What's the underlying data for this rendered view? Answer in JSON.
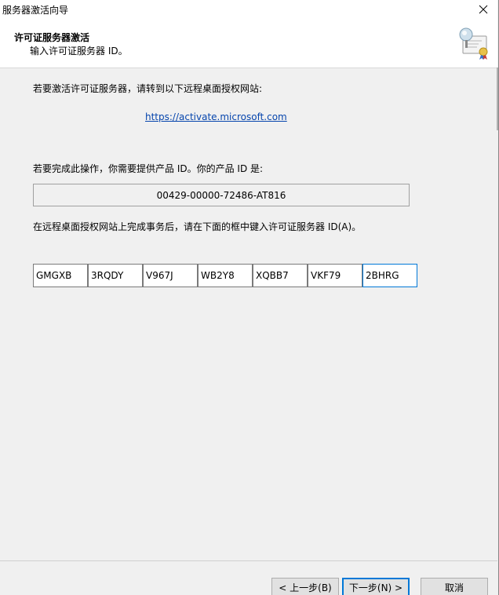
{
  "window": {
    "title": "服务器激活向导"
  },
  "header": {
    "title": "许可证服务器激活",
    "subtitle": "输入许可证服务器 ID。"
  },
  "content": {
    "intro_text": "若要激活许可证服务器，请转到以下远程桌面授权网站:",
    "link_text": "https://activate.microsoft.com",
    "product_id_text": "若要完成此操作，你需要提供产品 ID。你的产品 ID 是:",
    "product_id_value": "00429-00000-72486-AT816",
    "instruction_text": "在远程桌面授权网站上完成事务后，请在下面的框中键入许可证服务器 ID(A)。",
    "license_key_fields": [
      "GMGXB",
      "3RQDY",
      "V967J",
      "WB2Y8",
      "XQBB7",
      "VKF79",
      "2BHRG"
    ]
  },
  "buttons": {
    "back_label": "< 上一步(B)",
    "next_label": "下一步(N) >",
    "cancel_label": "取消"
  },
  "icons": {
    "close": "close-icon",
    "header": "certificate-icon"
  },
  "colors": {
    "link": "#0645ad",
    "focus_border": "#0078d7"
  }
}
